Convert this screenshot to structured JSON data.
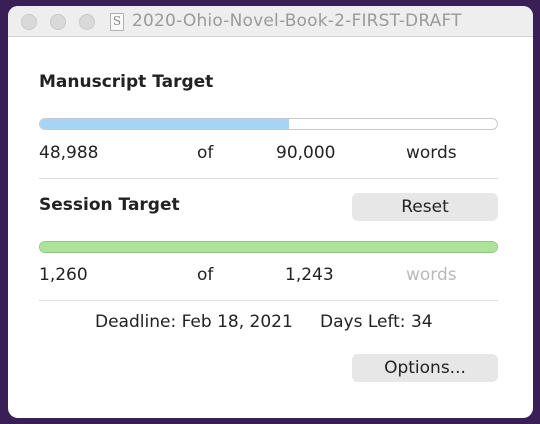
{
  "window": {
    "title": "2020-Ohio-Novel-Book-2-FIRST-DRAFT",
    "doc_icon_glyph": "S"
  },
  "manuscript": {
    "heading": "Manuscript Target",
    "current": "48,988",
    "of": "of",
    "target": "90,000",
    "unit": "words",
    "progress_fraction": 0.544,
    "bar_fill_color": "#a6d4f5",
    "bar_border_color": "#c9c9c9"
  },
  "session": {
    "heading": "Session Target",
    "reset_label": "Reset",
    "current": "1,260",
    "of": "of",
    "target": "1,243",
    "unit": "words",
    "progress_fraction": 1.0,
    "bar_fill_color": "#abe39b",
    "bar_border_color": "#93c884"
  },
  "footer": {
    "deadline": "Deadline: Feb 18, 2021",
    "days_left": "Days Left: 34",
    "options_label": "Options..."
  }
}
